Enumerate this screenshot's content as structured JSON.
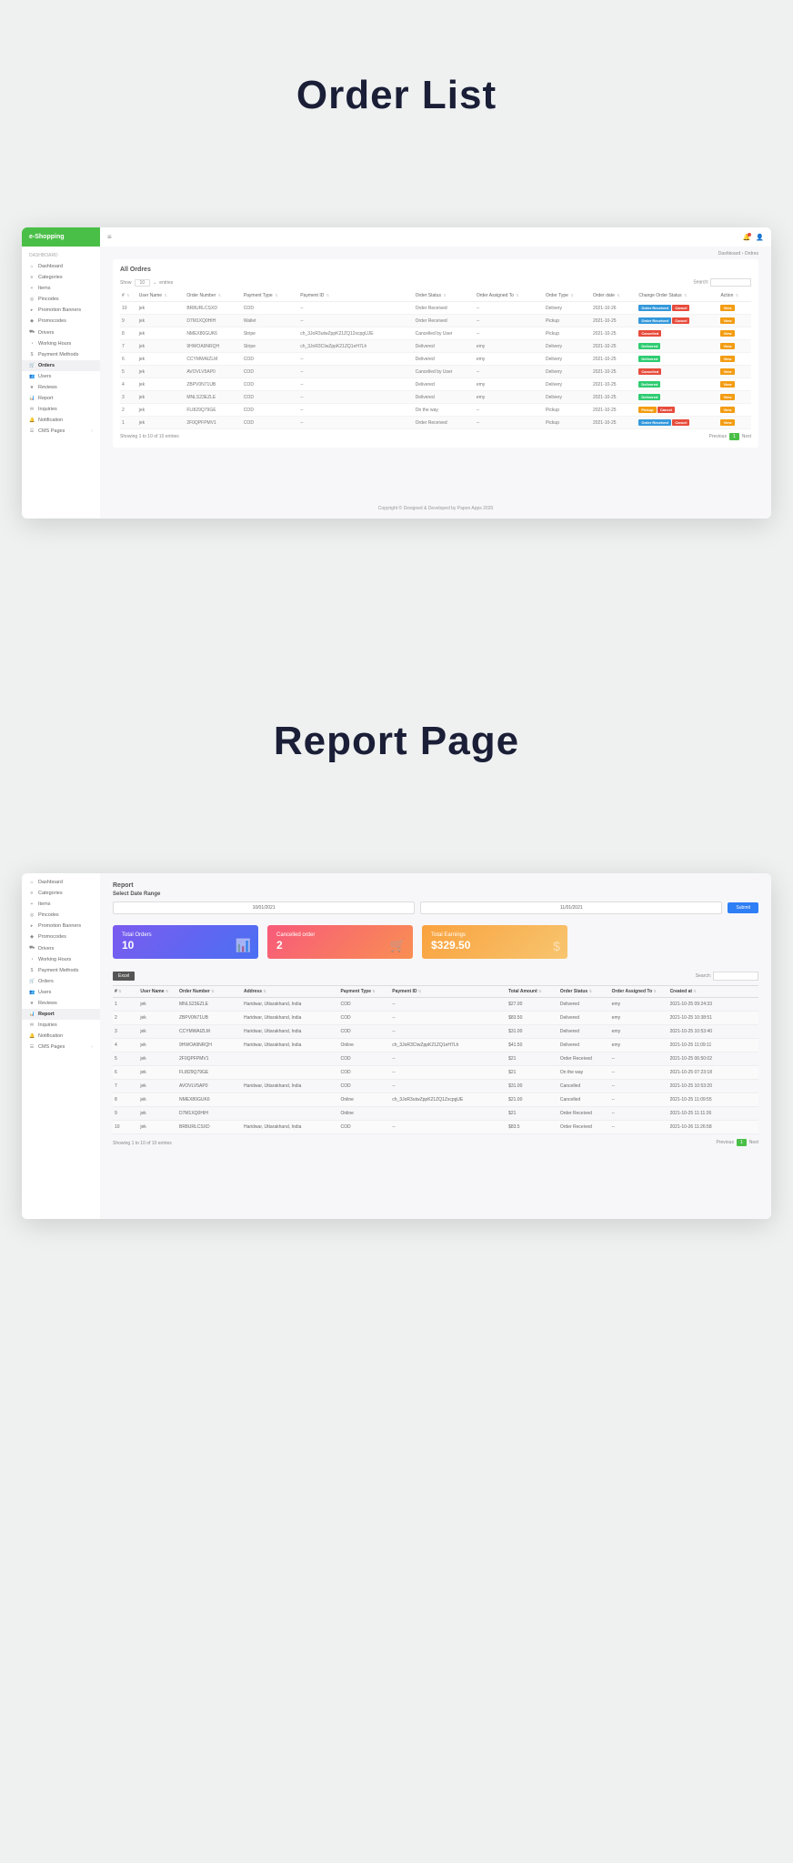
{
  "titles": {
    "orderList": "Order List",
    "reportPage": "Report Page"
  },
  "brand": "e-Shopping",
  "nav_header": "DASHBOARD",
  "nav": [
    {
      "icon": "⌂",
      "label": "Dashboard"
    },
    {
      "icon": "≡",
      "label": "Categories"
    },
    {
      "icon": "+",
      "label": "Items"
    },
    {
      "icon": "◎",
      "label": "Pincodes"
    },
    {
      "icon": "▸",
      "label": "Promotion Banners"
    },
    {
      "icon": "◆",
      "label": "Promocodes"
    },
    {
      "icon": "⛟",
      "label": "Drivers"
    },
    {
      "icon": "◔",
      "label": "Working Hours"
    },
    {
      "icon": "$",
      "label": "Payment Methods"
    },
    {
      "icon": "🛒",
      "label": "Orders",
      "active_ol": true
    },
    {
      "icon": "👥",
      "label": "Users"
    },
    {
      "icon": "★",
      "label": "Reviews"
    },
    {
      "icon": "📊",
      "label": "Report",
      "active_rp": true
    },
    {
      "icon": "✉",
      "label": "Inquiries"
    },
    {
      "icon": "🔔",
      "label": "Notification"
    },
    {
      "icon": "☰",
      "label": "CMS Pages",
      "chev": "›"
    }
  ],
  "breadcrumb": {
    "a": "Dashboard",
    "sep": "›",
    "b": "Ordres"
  },
  "orderList": {
    "title": "All Ordres",
    "show_label": "Show",
    "show_value": "10",
    "show_unit": "entries",
    "search_label": "Search:",
    "cols": [
      "#",
      "User Name",
      "Order Number",
      "Payment Type",
      "Payment ID",
      "Order Status",
      "Order Assigned To",
      "Order Type",
      "Order date",
      "Change Order Status",
      "Action"
    ],
    "action_label": "View",
    "rows": [
      {
        "n": "10",
        "user": "jek",
        "num": "BR8URLCSXD",
        "ptype": "COD",
        "pid": "--",
        "status": "Order Received",
        "driver": "--",
        "otype": "Delivery",
        "date": "2021-10-26",
        "cs": [
          {
            "t": "Order Received",
            "c": "b-blue"
          },
          {
            "t": "Cancel",
            "c": "b-red"
          }
        ]
      },
      {
        "n": "9",
        "user": "jek",
        "num": "D7M1XQ0HIH",
        "ptype": "Wallet",
        "pid": "--",
        "status": "Order Received",
        "driver": "--",
        "otype": "Pickup",
        "date": "2021-10-25",
        "cs": [
          {
            "t": "Order Received",
            "c": "b-blue"
          },
          {
            "t": "Cancel",
            "c": "b-red"
          }
        ]
      },
      {
        "n": "8",
        "user": "jek",
        "num": "NMEX80GUK6",
        "ptype": "Stripe",
        "pid": "ch_3JoR3utwZppK21ZQ12xcpgUJE",
        "status": "Cancelled by User",
        "driver": "--",
        "otype": "Pickup",
        "date": "2021-10-25",
        "cs": [
          {
            "t": "Cancelled",
            "c": "b-red"
          }
        ]
      },
      {
        "n": "7",
        "user": "jek",
        "num": "9HWOA9NRQH",
        "ptype": "Stripe",
        "pid": "ch_3JoR3CIwZppK21ZQ1eH7Lh",
        "status": "Delivered",
        "driver": "emy",
        "otype": "Delivery",
        "date": "2021-10-25",
        "cs": [
          {
            "t": "Delivered",
            "c": "b-green"
          }
        ]
      },
      {
        "n": "6",
        "user": "jek",
        "num": "CCYMWAIZLM",
        "ptype": "COD",
        "pid": "--",
        "status": "Delivered",
        "driver": "emy",
        "otype": "Delivery",
        "date": "2021-10-25",
        "cs": [
          {
            "t": "Delivered",
            "c": "b-green"
          }
        ]
      },
      {
        "n": "5",
        "user": "jek",
        "num": "AVOVLV5AP0",
        "ptype": "COD",
        "pid": "--",
        "status": "Cancelled by User",
        "driver": "--",
        "otype": "Delivery",
        "date": "2021-10-25",
        "cs": [
          {
            "t": "Cancelled",
            "c": "b-red"
          }
        ]
      },
      {
        "n": "4",
        "user": "jek",
        "num": "ZBPV0N71UB",
        "ptype": "COD",
        "pid": "--",
        "status": "Delivered",
        "driver": "emy",
        "otype": "Delivery",
        "date": "2021-10-25",
        "cs": [
          {
            "t": "Delivered",
            "c": "b-green"
          }
        ]
      },
      {
        "n": "3",
        "user": "jek",
        "num": "MNLS23EZLE",
        "ptype": "COD",
        "pid": "--",
        "status": "Delivered",
        "driver": "emy",
        "otype": "Delivery",
        "date": "2021-10-25",
        "cs": [
          {
            "t": "Delivered",
            "c": "b-green"
          }
        ]
      },
      {
        "n": "2",
        "user": "jek",
        "num": "FLI829Q79GE",
        "ptype": "COD",
        "pid": "--",
        "status": "On the way",
        "driver": "--",
        "otype": "Pickup",
        "date": "2021-10-25",
        "cs": [
          {
            "t": "Pickup",
            "c": "b-orange"
          },
          {
            "t": "Cancel",
            "c": "b-red"
          }
        ]
      },
      {
        "n": "1",
        "user": "jek",
        "num": "2F0QPFPMV1",
        "ptype": "COD",
        "pid": "--",
        "status": "Order Received",
        "driver": "--",
        "otype": "Pickup",
        "date": "2021-10-25",
        "cs": [
          {
            "t": "Order Received",
            "c": "b-blue"
          },
          {
            "t": "Cancel",
            "c": "b-red"
          }
        ]
      }
    ],
    "info": "Showing 1 to 10 of 10 entries",
    "prev": "Previous",
    "page": "1",
    "next": "Next",
    "footer": "Copyright © Designed & Developed by Papon Apps 2020"
  },
  "report": {
    "title": "Report",
    "subtitle": "Select Date Range",
    "date_from": "10/01/2021",
    "date_to": "11/01/2021",
    "submit": "Submit",
    "stats": [
      {
        "label": "Total Orders",
        "value": "10",
        "class": "g-blue",
        "icon": "📊"
      },
      {
        "label": "Cancelled order",
        "value": "2",
        "class": "g-pink",
        "icon": "🛒"
      },
      {
        "label": "Total Earnings",
        "value": "$329.50",
        "class": "g-orange",
        "icon": "$"
      }
    ],
    "excel": "Excel",
    "search_label": "Search:",
    "cols": [
      "#",
      "User Name",
      "Order Number",
      "Address",
      "Payment Type",
      "Payment ID",
      "Total Amount",
      "Order Status",
      "Order Assigned To",
      "Created at"
    ],
    "widths": [
      "4%",
      "6%",
      "10%",
      "15%",
      "8%",
      "18%",
      "8%",
      "8%",
      "9%",
      "14%"
    ],
    "rows": [
      {
        "n": "1",
        "user": "jek",
        "num": "MNLS23EZLE",
        "addr": "Haridwar, Uttarakhand, India",
        "ptype": "COD",
        "pid": "--",
        "amt": "$27.00",
        "status": "Delivered",
        "driver": "emy",
        "ts": "2021-10-25 09:24:33"
      },
      {
        "n": "2",
        "user": "jek",
        "num": "ZBPV0N71UB",
        "addr": "Haridwar, Uttarakhand, India",
        "ptype": "COD",
        "pid": "--",
        "amt": "$83.50",
        "status": "Delivered",
        "driver": "emy",
        "ts": "2021-10-25 10:38:51"
      },
      {
        "n": "3",
        "user": "jek",
        "num": "CCYMWAIZLM",
        "addr": "Haridwar, Uttarakhand, India",
        "ptype": "COD",
        "pid": "--",
        "amt": "$31.00",
        "status": "Delivered",
        "driver": "emy",
        "ts": "2021-10-25 10:53:40"
      },
      {
        "n": "4",
        "user": "jek",
        "num": "9HWOA9NRQH",
        "addr": "Haridwar, Uttarakhand, India",
        "ptype": "Online",
        "pid": "ch_3JoR3CIwZppK21ZQ1eH7Lh",
        "amt": "$41.50",
        "status": "Delivered",
        "driver": "emy",
        "ts": "2021-10-25 11:09:11"
      },
      {
        "n": "5",
        "user": "jek",
        "num": "2F0QPFPMV1",
        "addr": "",
        "ptype": "COD",
        "pid": "--",
        "amt": "$21",
        "status": "Order Received",
        "driver": "--",
        "ts": "2021-10-25 06:50:02"
      },
      {
        "n": "6",
        "user": "jek",
        "num": "FLI829Q79GE",
        "addr": "",
        "ptype": "COD",
        "pid": "--",
        "amt": "$21",
        "status": "On the way",
        "driver": "--",
        "ts": "2021-10-25 07:23:18"
      },
      {
        "n": "7",
        "user": "jek",
        "num": "AVOVLV5AP0",
        "addr": "Haridwar, Uttarakhand, India",
        "ptype": "COD",
        "pid": "--",
        "amt": "$31.00",
        "status": "Cancelled",
        "driver": "--",
        "ts": "2021-10-25 10:53:20"
      },
      {
        "n": "8",
        "user": "jek",
        "num": "NMEX80GUK6",
        "addr": "",
        "ptype": "Online",
        "pid": "ch_3JoR3utwZppK21ZQ1ZxcpgUE",
        "amt": "$21.00",
        "status": "Cancelled",
        "driver": "--",
        "ts": "2021-10-25 11:09:55"
      },
      {
        "n": "9",
        "user": "jek",
        "num": "D7M1XQ0HIH",
        "addr": "",
        "ptype": "Online",
        "pid": "",
        "amt": "$21",
        "status": "Order Received",
        "driver": "--",
        "ts": "2021-10-25 11:11:26"
      },
      {
        "n": "10",
        "user": "jek",
        "num": "BR8URLCSXD",
        "addr": "Haridwar, Uttarakhand, India",
        "ptype": "COD",
        "pid": "--",
        "amt": "$83.5",
        "status": "Order Received",
        "driver": "--",
        "ts": "2021-10-26 11:26:58"
      }
    ],
    "info": "Showing 1 to 10 of 10 entries",
    "prev": "Previous",
    "page": "1",
    "next": "Next"
  }
}
